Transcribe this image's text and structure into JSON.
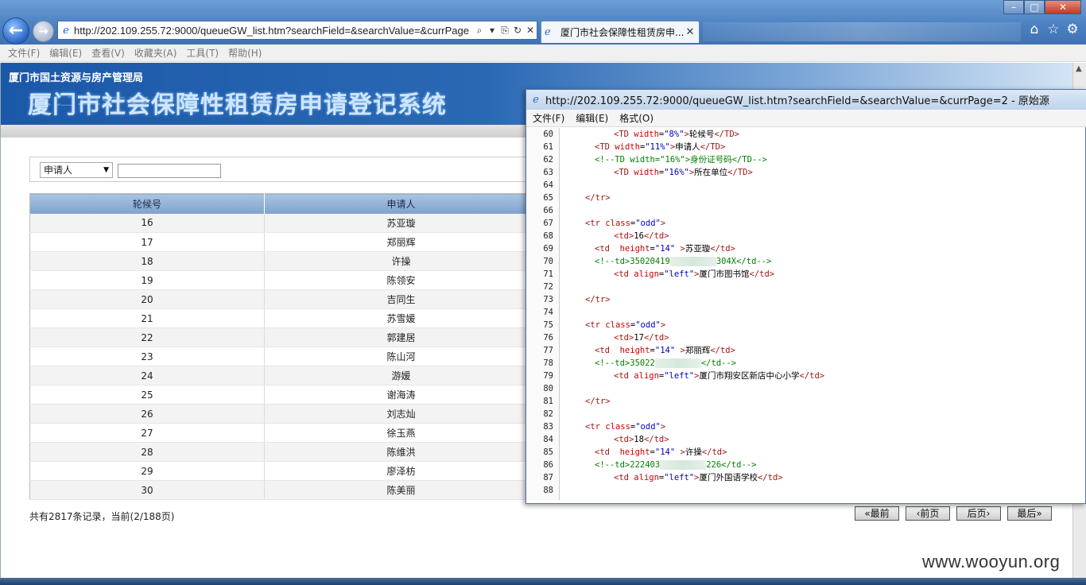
{
  "browser": {
    "url": "http://202.109.255.72:9000/queueGW_list.htm?searchField=&searchValue=&currPage",
    "tab_title": "厦门市社会保障性租赁房申...",
    "menu": [
      "文件(F)",
      "编辑(E)",
      "查看(V)",
      "收藏夹(A)",
      "工具(T)",
      "帮助(H)"
    ]
  },
  "page": {
    "org": "厦门市国土资源与房产管理局",
    "system_title": "厦门市社会保障性租赁房申请登记系统",
    "search": {
      "field_selected": "申请人",
      "value": ""
    },
    "table": {
      "headers": [
        "轮候号",
        "申请人"
      ],
      "rows": [
        [
          "16",
          "苏亚璇"
        ],
        [
          "17",
          "郑丽辉"
        ],
        [
          "18",
          "许操"
        ],
        [
          "19",
          "陈领安"
        ],
        [
          "20",
          "吉同生"
        ],
        [
          "21",
          "苏雪媛"
        ],
        [
          "22",
          "郭建居"
        ],
        [
          "23",
          "陈山河"
        ],
        [
          "24",
          "游媛"
        ],
        [
          "25",
          "谢海涛"
        ],
        [
          "26",
          "刘志灿"
        ],
        [
          "27",
          "徐玉燕"
        ],
        [
          "28",
          "陈维洪"
        ],
        [
          "29",
          "廖泽枋"
        ],
        [
          "30",
          "陈美丽"
        ]
      ]
    },
    "summary": "共有2817条记录，当前(2/188页)",
    "pager": [
      "最前",
      "前页",
      "后页",
      "最后"
    ]
  },
  "source_window": {
    "title": "http://202.109.255.72:9000/queueGW_list.htm?searchField=&searchValue=&currPage=2 - 原始源",
    "menu": [
      "文件(F)",
      "编辑(E)",
      "格式(O)"
    ],
    "lines": [
      {
        "n": "60",
        "indent": 1,
        "parts": [
          [
            "tag",
            "<TD "
          ],
          [
            "attr",
            "width"
          ],
          [
            "txt",
            "="
          ],
          [
            "str",
            "\"8%\""
          ],
          [
            "tag",
            ">"
          ],
          [
            "txt",
            "轮候号"
          ],
          [
            "tag",
            "</TD>"
          ]
        ]
      },
      {
        "n": "61",
        "indent": 2,
        "parts": [
          [
            "tag",
            "<TD "
          ],
          [
            "attr",
            "width"
          ],
          [
            "txt",
            "="
          ],
          [
            "str",
            "\"11%\""
          ],
          [
            "tag",
            ">"
          ],
          [
            "txt",
            "申请人"
          ],
          [
            "tag",
            "</TD>"
          ]
        ]
      },
      {
        "n": "62",
        "indent": 2,
        "parts": [
          [
            "cmt",
            "<!--TD width=\"16%\">身份证号码</TD-->"
          ]
        ]
      },
      {
        "n": "63",
        "indent": 1,
        "parts": [
          [
            "tag",
            "<TD "
          ],
          [
            "attr",
            "width"
          ],
          [
            "txt",
            "="
          ],
          [
            "str",
            "\"16%\""
          ],
          [
            "tag",
            ">"
          ],
          [
            "txt",
            "所在单位"
          ],
          [
            "tag",
            "</TD>"
          ]
        ]
      },
      {
        "n": "64",
        "indent": 0,
        "parts": []
      },
      {
        "n": "65",
        "indent": 3,
        "parts": [
          [
            "tag",
            "</tr>"
          ]
        ]
      },
      {
        "n": "66",
        "indent": 0,
        "parts": []
      },
      {
        "n": "67",
        "indent": 3,
        "parts": [
          [
            "tag",
            "<tr "
          ],
          [
            "attr",
            "class"
          ],
          [
            "txt",
            "="
          ],
          [
            "str",
            "\"odd\""
          ],
          [
            "tag",
            ">"
          ]
        ]
      },
      {
        "n": "68",
        "indent": 1,
        "parts": [
          [
            "tag",
            "<td>"
          ],
          [
            "txt",
            "16"
          ],
          [
            "tag",
            "</td>"
          ]
        ]
      },
      {
        "n": "69",
        "indent": 2,
        "parts": [
          [
            "tag",
            "<td  "
          ],
          [
            "attr",
            "height"
          ],
          [
            "txt",
            "="
          ],
          [
            "str",
            "\"14\""
          ],
          [
            "tag",
            " >"
          ],
          [
            "txt",
            "苏亚璇"
          ],
          [
            "tag",
            "</td>"
          ]
        ]
      },
      {
        "n": "70",
        "indent": 2,
        "parts": [
          [
            "cmt",
            "<!--td>35020419"
          ],
          [
            "blur",
            ""
          ],
          [
            "cmt",
            "304X</td-->"
          ]
        ]
      },
      {
        "n": "71",
        "indent": 1,
        "parts": [
          [
            "tag",
            "<td "
          ],
          [
            "attr",
            "align"
          ],
          [
            "txt",
            "="
          ],
          [
            "str",
            "\"left\""
          ],
          [
            "tag",
            ">"
          ],
          [
            "txt",
            "厦门市图书馆"
          ],
          [
            "tag",
            "</td>"
          ]
        ]
      },
      {
        "n": "72",
        "indent": 0,
        "parts": []
      },
      {
        "n": "73",
        "indent": 3,
        "parts": [
          [
            "tag",
            "</tr>"
          ]
        ]
      },
      {
        "n": "74",
        "indent": 0,
        "parts": []
      },
      {
        "n": "75",
        "indent": 3,
        "parts": [
          [
            "tag",
            "<tr "
          ],
          [
            "attr",
            "class"
          ],
          [
            "txt",
            "="
          ],
          [
            "str",
            "\"odd\""
          ],
          [
            "tag",
            ">"
          ]
        ]
      },
      {
        "n": "76",
        "indent": 1,
        "parts": [
          [
            "tag",
            "<td>"
          ],
          [
            "txt",
            "17"
          ],
          [
            "tag",
            "</td>"
          ]
        ]
      },
      {
        "n": "77",
        "indent": 2,
        "parts": [
          [
            "tag",
            "<td  "
          ],
          [
            "attr",
            "height"
          ],
          [
            "txt",
            "="
          ],
          [
            "str",
            "\"14\""
          ],
          [
            "tag",
            " >"
          ],
          [
            "txt",
            "郑丽辉"
          ],
          [
            "tag",
            "</td>"
          ]
        ]
      },
      {
        "n": "78",
        "indent": 2,
        "parts": [
          [
            "cmt",
            "<!--td>35022"
          ],
          [
            "blur",
            ""
          ],
          [
            "cmt",
            "</td-->"
          ]
        ]
      },
      {
        "n": "79",
        "indent": 1,
        "parts": [
          [
            "tag",
            "<td "
          ],
          [
            "attr",
            "align"
          ],
          [
            "txt",
            "="
          ],
          [
            "str",
            "\"left\""
          ],
          [
            "tag",
            ">"
          ],
          [
            "txt",
            "厦门市翔安区新店中心小学"
          ],
          [
            "tag",
            "</td>"
          ]
        ]
      },
      {
        "n": "80",
        "indent": 0,
        "parts": []
      },
      {
        "n": "81",
        "indent": 3,
        "parts": [
          [
            "tag",
            "</tr>"
          ]
        ]
      },
      {
        "n": "82",
        "indent": 0,
        "parts": []
      },
      {
        "n": "83",
        "indent": 3,
        "parts": [
          [
            "tag",
            "<tr "
          ],
          [
            "attr",
            "class"
          ],
          [
            "txt",
            "="
          ],
          [
            "str",
            "\"odd\""
          ],
          [
            "tag",
            ">"
          ]
        ]
      },
      {
        "n": "84",
        "indent": 1,
        "parts": [
          [
            "tag",
            "<td>"
          ],
          [
            "txt",
            "18"
          ],
          [
            "tag",
            "</td>"
          ]
        ]
      },
      {
        "n": "85",
        "indent": 2,
        "parts": [
          [
            "tag",
            "<td  "
          ],
          [
            "attr",
            "height"
          ],
          [
            "txt",
            "="
          ],
          [
            "str",
            "\"14\""
          ],
          [
            "tag",
            " >"
          ],
          [
            "txt",
            "许操"
          ],
          [
            "tag",
            "</td>"
          ]
        ]
      },
      {
        "n": "86",
        "indent": 2,
        "parts": [
          [
            "cmt",
            "<!--td>222403"
          ],
          [
            "blur",
            ""
          ],
          [
            "cmt",
            "226</td-->"
          ]
        ]
      },
      {
        "n": "87",
        "indent": 1,
        "parts": [
          [
            "tag",
            "<td "
          ],
          [
            "attr",
            "align"
          ],
          [
            "txt",
            "="
          ],
          [
            "str",
            "\"left\""
          ],
          [
            "tag",
            ">"
          ],
          [
            "txt",
            "厦门外国语学校"
          ],
          [
            "tag",
            "</td>"
          ]
        ]
      },
      {
        "n": "88",
        "indent": 0,
        "parts": []
      }
    ]
  },
  "watermark": "www.wooyun.org"
}
